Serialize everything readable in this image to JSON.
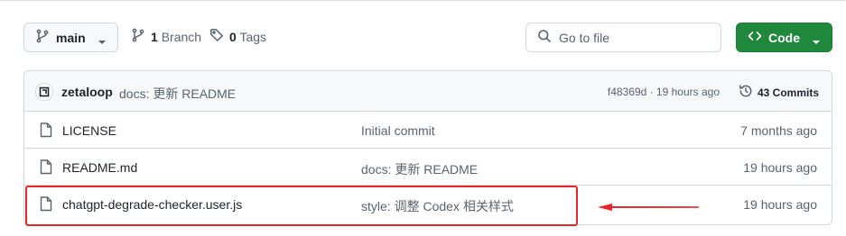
{
  "toolbar": {
    "branch_label": "main",
    "branch_count": "1",
    "branch_word": "Branch",
    "tag_count": "0",
    "tag_word": "Tags",
    "search_placeholder": "Go to file",
    "code_label": "Code"
  },
  "commit": {
    "author": "zetaloop",
    "message": "docs: 更新 README",
    "hash_time": "f48369d · 19 hours ago",
    "commits_label": "43 Commits"
  },
  "files": [
    {
      "name": "LICENSE",
      "message": "Initial commit",
      "age": "7 months ago"
    },
    {
      "name": "README.md",
      "message": "docs: 更新 README",
      "age": "19 hours ago"
    },
    {
      "name": "chatgpt-degrade-checker.user.js",
      "message": "style: 调整 Codex 相关样式",
      "age": "19 hours ago"
    }
  ],
  "colors": {
    "accent_green": "#1f883d",
    "annotation_red": "#e8262a",
    "muted_text": "#59636e"
  },
  "icons": {
    "branch": "git-branch-icon",
    "tag": "tag-icon",
    "search": "search-icon",
    "code": "code-icon",
    "history": "history-icon",
    "file": "file-icon"
  }
}
